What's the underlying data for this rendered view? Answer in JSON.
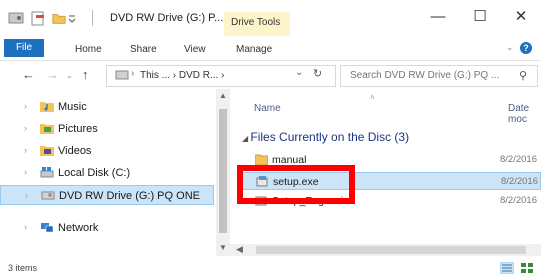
{
  "window": {
    "title": "DVD RW Drive (G:) P...",
    "context_tab": "Drive Tools",
    "controls": {
      "minimize": "—",
      "maximize": "☐",
      "close": "✕"
    }
  },
  "ribbon": {
    "tabs": [
      "File",
      "Home",
      "Share",
      "View",
      "Manage"
    ],
    "help": "?"
  },
  "address_bar": {
    "path": "This ... › DVD R... ›",
    "search_placeholder": "Search DVD RW Drive (G:) PQ ..."
  },
  "navigation": {
    "items": [
      {
        "label": "Music",
        "icon": "music-folder-icon"
      },
      {
        "label": "Pictures",
        "icon": "pictures-folder-icon"
      },
      {
        "label": "Videos",
        "icon": "videos-folder-icon"
      },
      {
        "label": "Local Disk (C:)",
        "icon": "local-disk-icon"
      },
      {
        "label": "DVD RW Drive (G:) PQ ONE",
        "icon": "dvd-drive-icon",
        "selected": true
      },
      {
        "label": "Network",
        "icon": "network-icon"
      }
    ]
  },
  "content": {
    "columns": {
      "name": "Name",
      "date": "Date moc"
    },
    "group_header": "Files Currently on the Disc (3)",
    "files": [
      {
        "name": "manual",
        "date": "8/2/2016",
        "icon": "folder-icon"
      },
      {
        "name": "setup.exe",
        "date": "8/2/2016",
        "icon": "setup-exe-icon",
        "selected": true
      },
      {
        "name": "Setup_Eng.msi",
        "date": "8/2/2016",
        "icon": "msi-installer-icon"
      }
    ]
  },
  "status": {
    "item_count": "3 items"
  },
  "colors": {
    "accent": "#1f6fbf",
    "selection": "#cce4f7",
    "highlight_box": "#ff0000",
    "drive_tools": "#fdf5c9"
  }
}
